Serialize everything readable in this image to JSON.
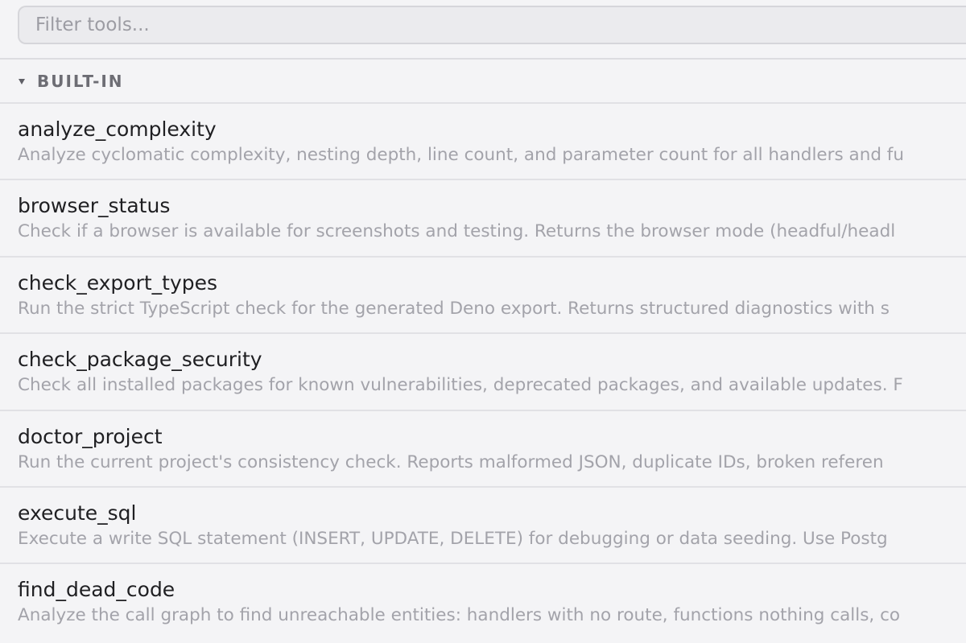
{
  "search": {
    "placeholder": "Filter tools..."
  },
  "section": {
    "title": "BUILT-IN",
    "expanded": true
  },
  "tools": [
    {
      "name": "analyze_complexity",
      "description": "Analyze cyclomatic complexity, nesting depth, line count, and parameter count for all handlers and fu"
    },
    {
      "name": "browser_status",
      "description": "Check if a browser is available for screenshots and testing. Returns the browser mode (headful/headl"
    },
    {
      "name": "check_export_types",
      "description": "Run the strict TypeScript check for the generated Deno export. Returns structured diagnostics with s"
    },
    {
      "name": "check_package_security",
      "description": "Check all installed packages for known vulnerabilities, deprecated packages, and available updates. F"
    },
    {
      "name": "doctor_project",
      "description": "Run the current project's consistency check. Reports malformed JSON, duplicate IDs, broken referen"
    },
    {
      "name": "execute_sql",
      "description": "Execute a write SQL statement (INSERT, UPDATE, DELETE) for debugging or data seeding. Use Postg"
    },
    {
      "name": "find_dead_code",
      "description": "Analyze the call graph to find unreachable entities: handlers with no route, functions nothing calls, co"
    }
  ]
}
